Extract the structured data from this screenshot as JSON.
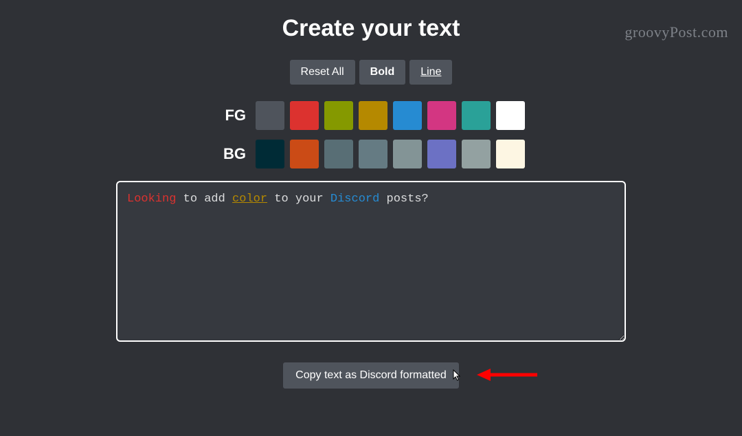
{
  "watermark": "groovyPost.com",
  "header": {
    "title": "Create your text"
  },
  "toolbar": {
    "reset_label": "Reset All",
    "bold_label": "Bold",
    "line_label": "Line"
  },
  "fg": {
    "label": "FG",
    "swatches": [
      {
        "name": "fg-gray",
        "hex": "#4f545c"
      },
      {
        "name": "fg-red",
        "hex": "#dc322f"
      },
      {
        "name": "fg-olive",
        "hex": "#859900"
      },
      {
        "name": "fg-yellow",
        "hex": "#b58900"
      },
      {
        "name": "fg-blue",
        "hex": "#268bd2"
      },
      {
        "name": "fg-magenta",
        "hex": "#d33682"
      },
      {
        "name": "fg-cyan",
        "hex": "#2aa198"
      },
      {
        "name": "fg-white",
        "hex": "#ffffff"
      }
    ]
  },
  "bg": {
    "label": "BG",
    "swatches": [
      {
        "name": "bg-darkteal",
        "hex": "#002b36"
      },
      {
        "name": "bg-orange",
        "hex": "#cb4b16"
      },
      {
        "name": "bg-slate",
        "hex": "#586e75"
      },
      {
        "name": "bg-gray",
        "hex": "#657b83"
      },
      {
        "name": "bg-bluegray",
        "hex": "#839496"
      },
      {
        "name": "bg-indigo",
        "hex": "#6c71c4"
      },
      {
        "name": "bg-lightgray",
        "hex": "#93a1a1"
      },
      {
        "name": "bg-cream",
        "hex": "#fdf6e3"
      }
    ]
  },
  "editor": {
    "segments": [
      {
        "text": "Looking",
        "cls": "seg-red"
      },
      {
        "text": " to add ",
        "cls": "seg-plain"
      },
      {
        "text": "color",
        "cls": "seg-yellow"
      },
      {
        "text": " to your ",
        "cls": "seg-plain"
      },
      {
        "text": "Discord",
        "cls": "seg-blue"
      },
      {
        "text": " posts?",
        "cls": "seg-plain"
      }
    ]
  },
  "copy": {
    "label": "Copy text as Discord formatted"
  }
}
